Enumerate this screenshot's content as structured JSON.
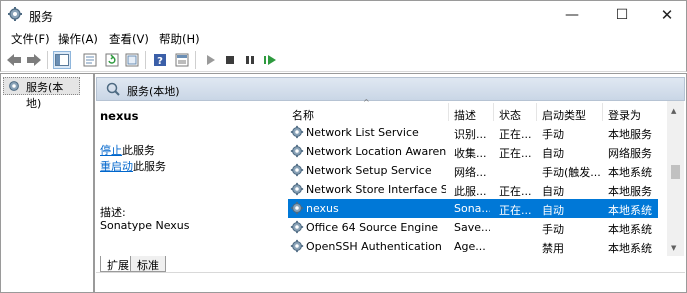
{
  "window": {
    "title": "服务",
    "min": "—",
    "max": "☐",
    "close": "✕"
  },
  "menu": [
    "文件(F)",
    "操作(A)",
    "查看(V)",
    "帮助(H)"
  ],
  "tree": {
    "selected": "服务(本地)"
  },
  "panel": {
    "title": "服务(本地)"
  },
  "detail": {
    "service_name": "nexus",
    "stop_link": "停止",
    "stop_suffix": "此服务",
    "restart_link": "重启动",
    "restart_suffix": "此服务",
    "desc_label": "描述:",
    "desc": "Sonatype Nexus"
  },
  "list": {
    "columns": [
      "名称",
      "描述",
      "状态",
      "启动类型",
      "登录为"
    ],
    "rows": [
      {
        "name": "Network List Service",
        "desc": "识别...",
        "status": "正在...",
        "startup": "手动",
        "logon": "本地服务"
      },
      {
        "name": "Network Location Awarene...",
        "desc": "收集...",
        "status": "正在...",
        "startup": "自动",
        "logon": "网络服务"
      },
      {
        "name": "Network Setup Service",
        "desc": "网络...",
        "status": "",
        "startup": "手动(触发...",
        "logon": "本地系统"
      },
      {
        "name": "Network Store Interface Se...",
        "desc": "此服...",
        "status": "正在...",
        "startup": "自动",
        "logon": "本地服务"
      },
      {
        "name": "nexus",
        "desc": "Sona...",
        "status": "正在...",
        "startup": "自动",
        "logon": "本地系统"
      },
      {
        "name": "Office 64 Source Engine",
        "desc": "Save...",
        "status": "",
        "startup": "手动",
        "logon": "本地系统"
      },
      {
        "name": "OpenSSH Authentication ...",
        "desc": "Age...",
        "status": "",
        "startup": "禁用",
        "logon": "本地系统"
      }
    ],
    "selected_index": 4
  },
  "tabs": [
    "扩展",
    "标准"
  ]
}
